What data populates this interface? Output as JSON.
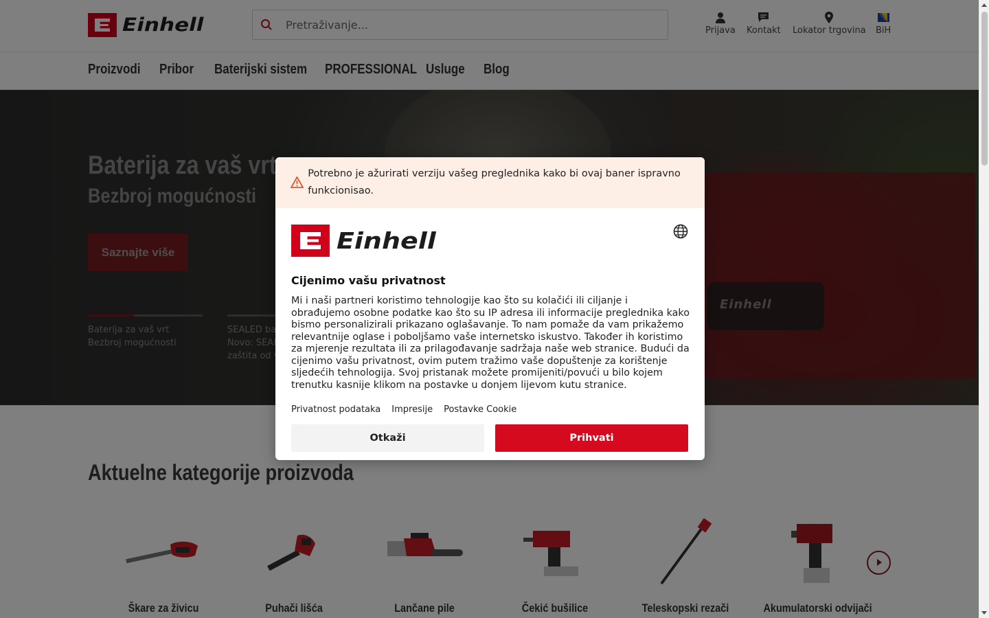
{
  "brand": {
    "name": "Einhell",
    "color": "#d0021b"
  },
  "header": {
    "search_placeholder": "Pretraživanje...",
    "icons": [
      {
        "label": "Prijava",
        "icon": "user-icon"
      },
      {
        "label": "Kontakt",
        "icon": "chat-icon"
      },
      {
        "label": "Lokator trgovina",
        "icon": "location-pin-icon"
      },
      {
        "label": "BiH",
        "icon": "flag-bih-icon"
      }
    ]
  },
  "nav": {
    "items": [
      "Proizvodi",
      "Pribor",
      "Baterijski sistem",
      "PROFESSIONAL",
      "Usluge",
      "Blog"
    ]
  },
  "hero": {
    "title": "Baterija za vaš vrt",
    "subtitle": "Bezbroj mogućnosti",
    "cta": "Saznajte više",
    "tool_text": "Einhell",
    "slides": [
      {
        "line1": "Baterija za vaš vrt",
        "line2": "Bezbroj mogućnosti",
        "line3": "",
        "progress": 0.4
      },
      {
        "line1": "SEALED bat",
        "line2": "Novo: SEAL",
        "line3": "zaštita od v",
        "progress": 0
      }
    ]
  },
  "categories": {
    "title": "Aktuelne kategorije proizvoda",
    "items": [
      {
        "label": "Škare za živicu",
        "icon": "hedge-trimmer-icon"
      },
      {
        "label": "Puhači lišća",
        "icon": "leaf-blower-icon"
      },
      {
        "label": "Lančane pile",
        "icon": "chainsaw-icon"
      },
      {
        "label": "Čekić bušilice",
        "icon": "hammer-drill-icon"
      },
      {
        "label": "Teleskopski rezači",
        "icon": "pole-pruner-icon"
      },
      {
        "label": "Akumulatorski odvijači",
        "icon": "impact-wrench-icon"
      }
    ],
    "next_icon": "chevron-right-icon"
  },
  "consent": {
    "warning": "Potrebno je ažurirati verziju vašeg preglednika kako bi ovaj baner ispravno funkcionisao.",
    "title": "Cijenimo vašu privatnost",
    "body": "Mi i naši partneri koristimo tehnologije kao što su kolačići ili ciljanje i obrađujemo osobne podatke kao što su IP adresa ili informacije preglednika kako bismo personalizirali prikazano oglašavanje. To nam pomaže da vam prikažemo relevantnije oglase i poboljšamo vaše internetsko iskustvo. Također ih koristimo za mjerenje rezultata ili za prilagođavanje sadržaja naše web stranice. Budući da cijenimo vašu privatnost, ovim putem tražimo vaše dopuštenje za korištenje sljedećih tehnologija. Svoj pristanak možete promijeniti/povući u bilo kojem trenutku kasnije klikom na postavke u donjem lijevom kutu stranice.",
    "links": [
      "Privatnost podataka",
      "Impresije",
      "Postavke Cookie"
    ],
    "cancel": "Otkaži",
    "accept": "Prihvati",
    "accept_color": "#d60a1e"
  }
}
